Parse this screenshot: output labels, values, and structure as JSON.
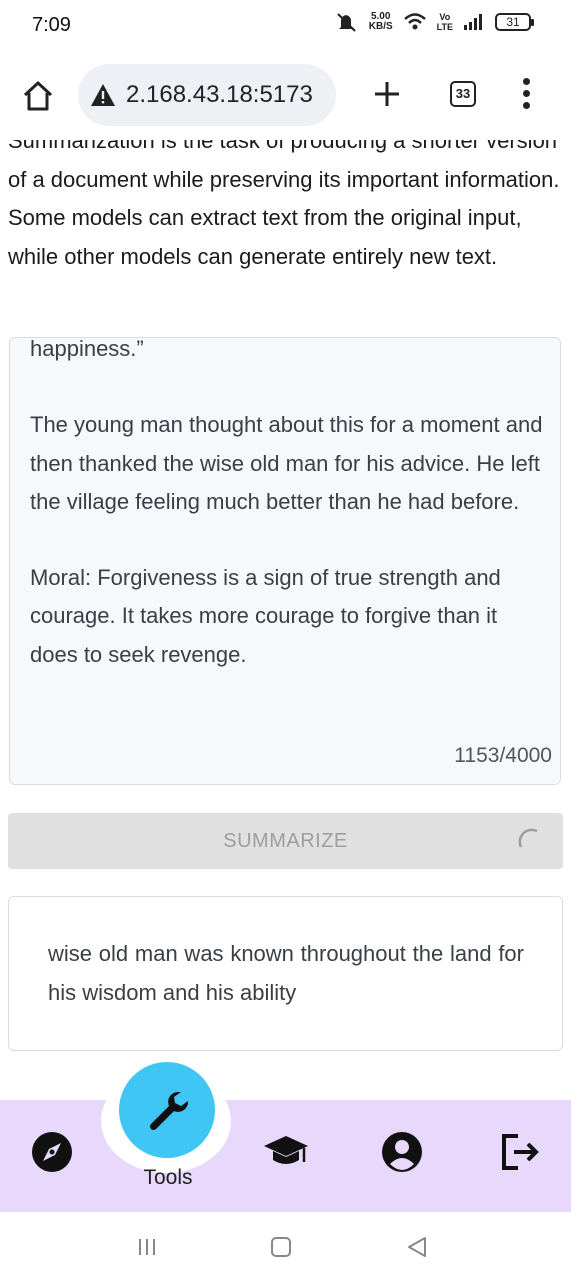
{
  "status_bar": {
    "time": "7:09",
    "speed_value": "5.00",
    "speed_unit": "KB/S",
    "volte": "Vo\nLTE",
    "battery": "31"
  },
  "browser": {
    "url": "2.168.43.18:5173",
    "tab_count": "33"
  },
  "description": "Summarization is the task of producing a shorter version of a document while preserving its important information. Some models can extract text from the original input, while other models can generate entirely new text.",
  "input_text": "happiness.”\n\nThe young man thought about this for a moment and then thanked the wise old man for his advice. He left the village feeling much better than he had before.\n\nMoral: Forgiveness is a sign of true strength and courage. It takes more courage to forgive than it does to seek revenge.",
  "char_count": "1153/4000",
  "summarize_label": "SUMMARIZE",
  "summary_text": "wise old man was known throughout the land for his wisdom and his ability",
  "bottom_nav": {
    "active_label": "Tools"
  },
  "colors": {
    "fab": "#3fc6f4",
    "nav_bg": "#e8d8fb",
    "button_disabled": "#e0e0e0"
  },
  "icons": [
    "home-icon",
    "warning-icon",
    "plus-icon",
    "tabs-icon",
    "more-vert-icon",
    "compass-icon",
    "wrench-icon",
    "graduation-cap-icon",
    "account-icon",
    "logout-icon"
  ]
}
